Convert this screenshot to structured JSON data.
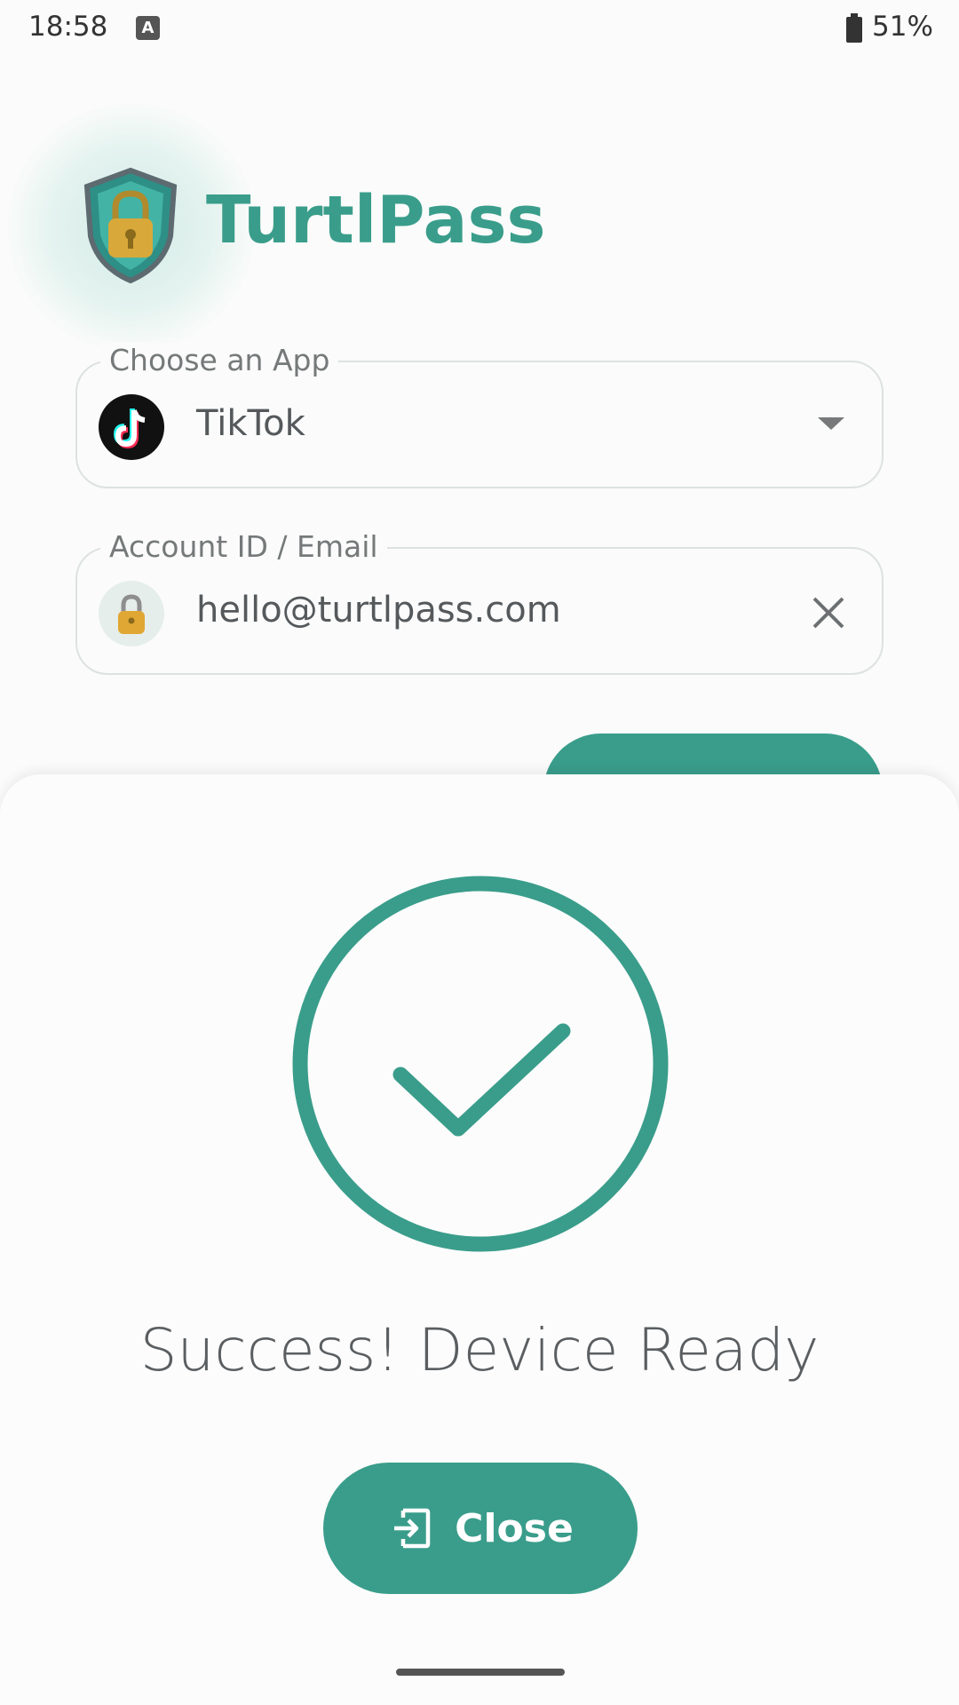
{
  "status_bar": {
    "time": "18:58",
    "notification_glyph": "A",
    "battery": "51%",
    "battery_icon": "battery-icon"
  },
  "header": {
    "app_name": "TurtlPass",
    "logo_icon": "shield-lock-icon"
  },
  "app_field": {
    "label": "Choose an App",
    "value": "TikTok",
    "icon": "tiktok-icon"
  },
  "account_field": {
    "label": "Account ID / Email",
    "value": "hello@turtlpass.com",
    "icon": "lock-avatar-icon"
  },
  "dialog": {
    "message": "Success! Device Ready",
    "close_label": "Close",
    "close_icon": "exit-icon",
    "status_icon": "check-circle-icon"
  },
  "colors": {
    "accent": "#3a9d8b",
    "background": "#fafbfa",
    "text": "#5a5e61"
  }
}
